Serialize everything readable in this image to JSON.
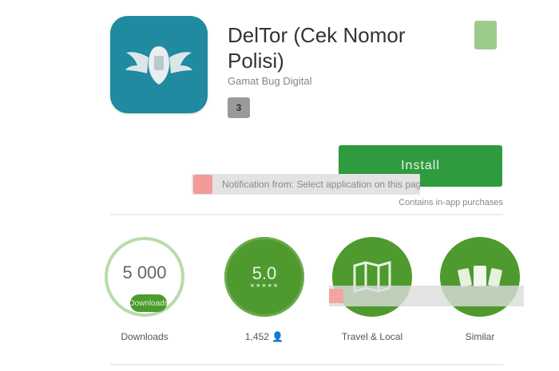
{
  "app": {
    "title": "DelTor (Cek Nomor Polisi)",
    "developer": "Gamat Bug Digital",
    "rating_badge": "3"
  },
  "install": {
    "label": "Install",
    "notice": "Notification from: Select application on this page to continue",
    "purchase_note": "Contains in-app purchases"
  },
  "stats": [
    {
      "value": "5 000",
      "pill": "Downloads",
      "label": "Downloads"
    },
    {
      "value": "5.0",
      "stars": "★★★★★",
      "label": "1,452 👤"
    },
    {
      "label": "Travel & Local"
    },
    {
      "label": "Similar"
    }
  ],
  "colors": {
    "icon_bg": "#1f8aa0",
    "accent_green": "#2f9b3f",
    "badge_green": "#4e9a2e",
    "ring_green": "#b9dcaa"
  },
  "icons": {
    "app": "winged-shield-icon",
    "bookmark": "wishlist-icon",
    "category": "map-icon",
    "similar": "cards-icon"
  }
}
